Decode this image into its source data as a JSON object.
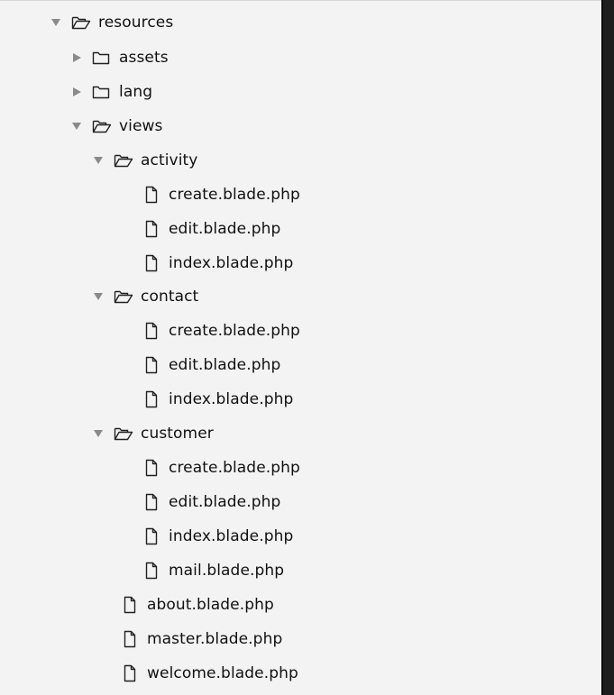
{
  "window": {
    "panel_background": "#f3f3f3",
    "right_strip_color": "#1e1e1e"
  },
  "tree": {
    "resources": {
      "label": "resources",
      "icon": "folder-open-icon",
      "expanded": true
    },
    "assets": {
      "label": "assets",
      "icon": "folder-icon",
      "expanded": false
    },
    "lang": {
      "label": "lang",
      "icon": "folder-icon",
      "expanded": false
    },
    "views": {
      "label": "views",
      "icon": "folder-open-icon",
      "expanded": true
    },
    "activity": {
      "label": "activity",
      "icon": "folder-open-icon",
      "expanded": true
    },
    "activity_create": {
      "label": "create.blade.php",
      "icon": "file-icon"
    },
    "activity_edit": {
      "label": "edit.blade.php",
      "icon": "file-icon"
    },
    "activity_index": {
      "label": "index.blade.php",
      "icon": "file-icon"
    },
    "contact": {
      "label": "contact",
      "icon": "folder-open-icon",
      "expanded": true
    },
    "contact_create": {
      "label": "create.blade.php",
      "icon": "file-icon"
    },
    "contact_edit": {
      "label": "edit.blade.php",
      "icon": "file-icon"
    },
    "contact_index": {
      "label": "index.blade.php",
      "icon": "file-icon"
    },
    "customer": {
      "label": "customer",
      "icon": "folder-open-icon",
      "expanded": true
    },
    "customer_create": {
      "label": "create.blade.php",
      "icon": "file-icon"
    },
    "customer_edit": {
      "label": "edit.blade.php",
      "icon": "file-icon"
    },
    "customer_index": {
      "label": "index.blade.php",
      "icon": "file-icon"
    },
    "customer_mail": {
      "label": "mail.blade.php",
      "icon": "file-icon"
    },
    "about": {
      "label": "about.blade.php",
      "icon": "file-icon"
    },
    "master": {
      "label": "master.blade.php",
      "icon": "file-icon"
    },
    "welcome": {
      "label": "welcome.blade.php",
      "icon": "file-icon"
    }
  }
}
